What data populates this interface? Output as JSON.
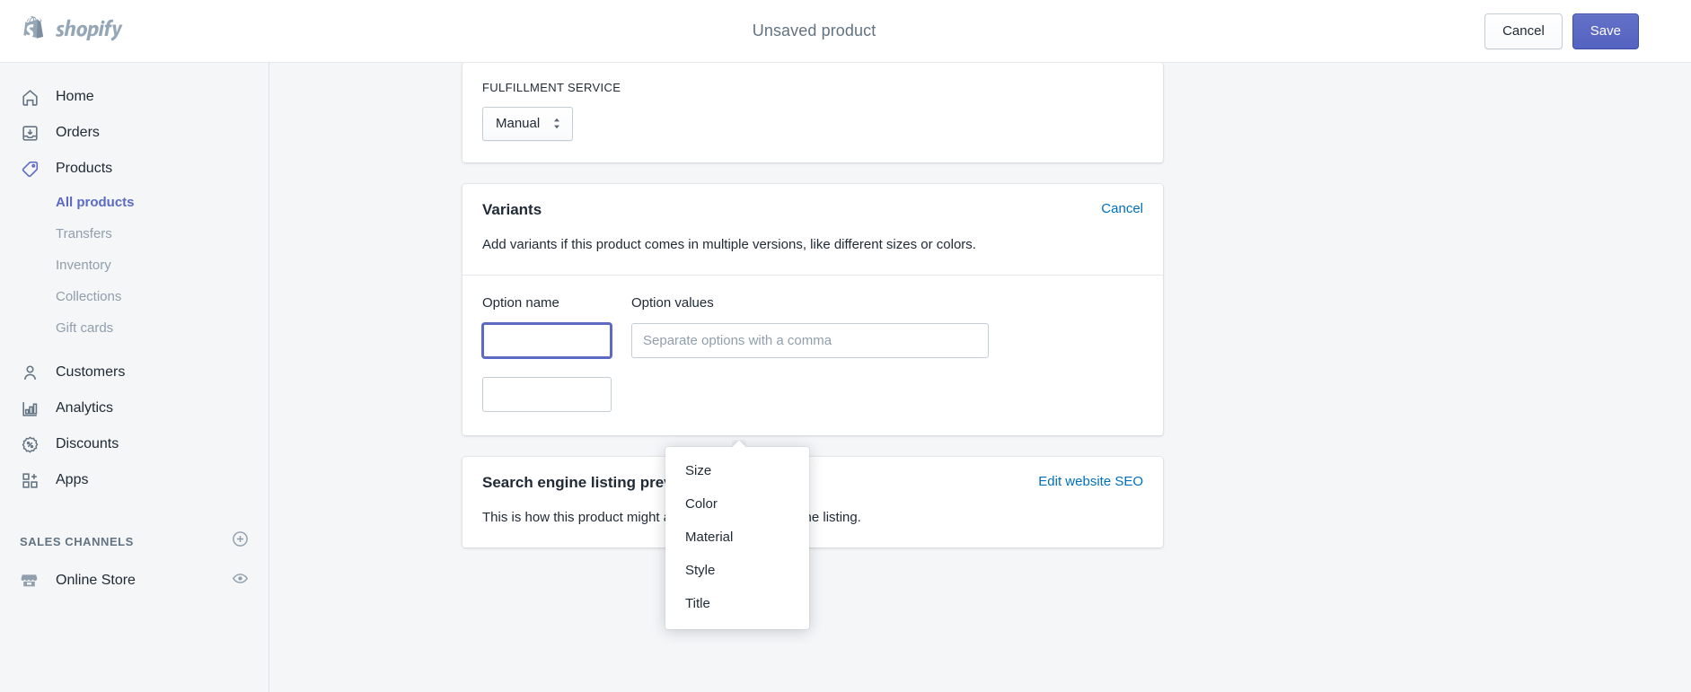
{
  "brand": {
    "logo_text": "shopify",
    "accent": "#5c6ac4",
    "link_color": "#006fbb"
  },
  "topbar": {
    "title": "Unsaved product",
    "cancel_label": "Cancel",
    "save_label": "Save"
  },
  "sidebar": {
    "items": [
      {
        "label": "Home",
        "icon": "home-icon"
      },
      {
        "label": "Orders",
        "icon": "orders-icon"
      },
      {
        "label": "Products",
        "icon": "products-tag-icon"
      }
    ],
    "product_subitems": [
      {
        "label": "All products",
        "selected": true
      },
      {
        "label": "Transfers",
        "selected": false
      },
      {
        "label": "Inventory",
        "selected": false
      },
      {
        "label": "Collections",
        "selected": false
      },
      {
        "label": "Gift cards",
        "selected": false
      }
    ],
    "items_after": [
      {
        "label": "Customers",
        "icon": "customers-person-icon"
      },
      {
        "label": "Analytics",
        "icon": "analytics-bar-chart-icon"
      },
      {
        "label": "Discounts",
        "icon": "discounts-percent-badge-icon"
      },
      {
        "label": "Apps",
        "icon": "apps-grid-plus-icon"
      }
    ],
    "sales_channels": {
      "heading": "SALES CHANNELS",
      "add_icon": "plus-circle-icon",
      "channels": [
        {
          "label": "Online Store",
          "icon": "storefront-icon",
          "action_icon": "eye-icon"
        }
      ]
    }
  },
  "main": {
    "fulfillment_card": {
      "label": "FULFILLMENT SERVICE",
      "select_value": "Manual"
    },
    "variants_card": {
      "title": "Variants",
      "action_label": "Cancel",
      "description": "Add variants if this product comes in multiple versions, like different sizes or colors.",
      "option_name_label": "Option name",
      "option_values_label": "Option values",
      "option_name_value": "",
      "option_name_placeholder": "",
      "option_values_value": "",
      "option_values_placeholder": "Separate options with a comma"
    },
    "seo_card": {
      "title": "Search engine listing preview",
      "action_label": "Edit website SEO",
      "description": "This is how this product might appear in a search engine listing."
    }
  },
  "dropdown": {
    "items": [
      {
        "label": "Size"
      },
      {
        "label": "Color"
      },
      {
        "label": "Material"
      },
      {
        "label": "Style"
      },
      {
        "label": "Title"
      }
    ]
  }
}
